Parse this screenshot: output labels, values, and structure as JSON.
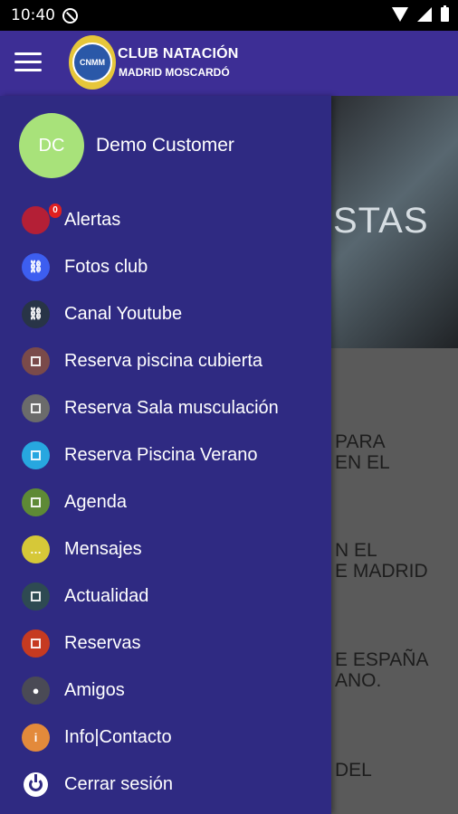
{
  "status_bar": {
    "time": "10:40"
  },
  "app_bar": {
    "title": "CLUB NATACIÓN",
    "subtitle": "MADRID MOSCARDÓ",
    "logo_text": "CNMM"
  },
  "user": {
    "initials": "DC",
    "name": "Demo Customer"
  },
  "menu": [
    {
      "label": "Alertas",
      "icon": "bell-icon",
      "color": "#b41f36",
      "badge": "0"
    },
    {
      "label": "Fotos club",
      "icon": "link-icon",
      "color": "#3d5ef0"
    },
    {
      "label": "Canal Youtube",
      "icon": "link-icon",
      "color": "#283447"
    },
    {
      "label": "Reserva piscina cubierta",
      "icon": "calendar-icon",
      "color": "#7a4a4a"
    },
    {
      "label": "Reserva Sala musculación",
      "icon": "calendar-icon",
      "color": "#6b6b6b"
    },
    {
      "label": "Reserva Piscina Verano",
      "icon": "calendar-icon",
      "color": "#27a7e0"
    },
    {
      "label": "Agenda",
      "icon": "agenda-icon",
      "color": "#5e8a36"
    },
    {
      "label": "Mensajes",
      "icon": "chat-icon",
      "color": "#d6c838"
    },
    {
      "label": "Actualidad",
      "icon": "news-icon",
      "color": "#2e4a52"
    },
    {
      "label": "Reservas",
      "icon": "booking-icon",
      "color": "#c63a21"
    },
    {
      "label": "Amigos",
      "icon": "friends-icon",
      "color": "#4a4a55"
    },
    {
      "label": "Info|Contacto",
      "icon": "info-icon",
      "color": "#e38a3b"
    },
    {
      "label": "Cerrar sesión",
      "icon": "power-icon",
      "color": "#ffffff"
    }
  ],
  "background_content": {
    "hero_text": "STAS",
    "lines": [
      "PARA",
      "EN EL",
      "N EL",
      "E MADRID",
      "E ESPAÑA",
      "ANO.",
      "DEL"
    ]
  }
}
